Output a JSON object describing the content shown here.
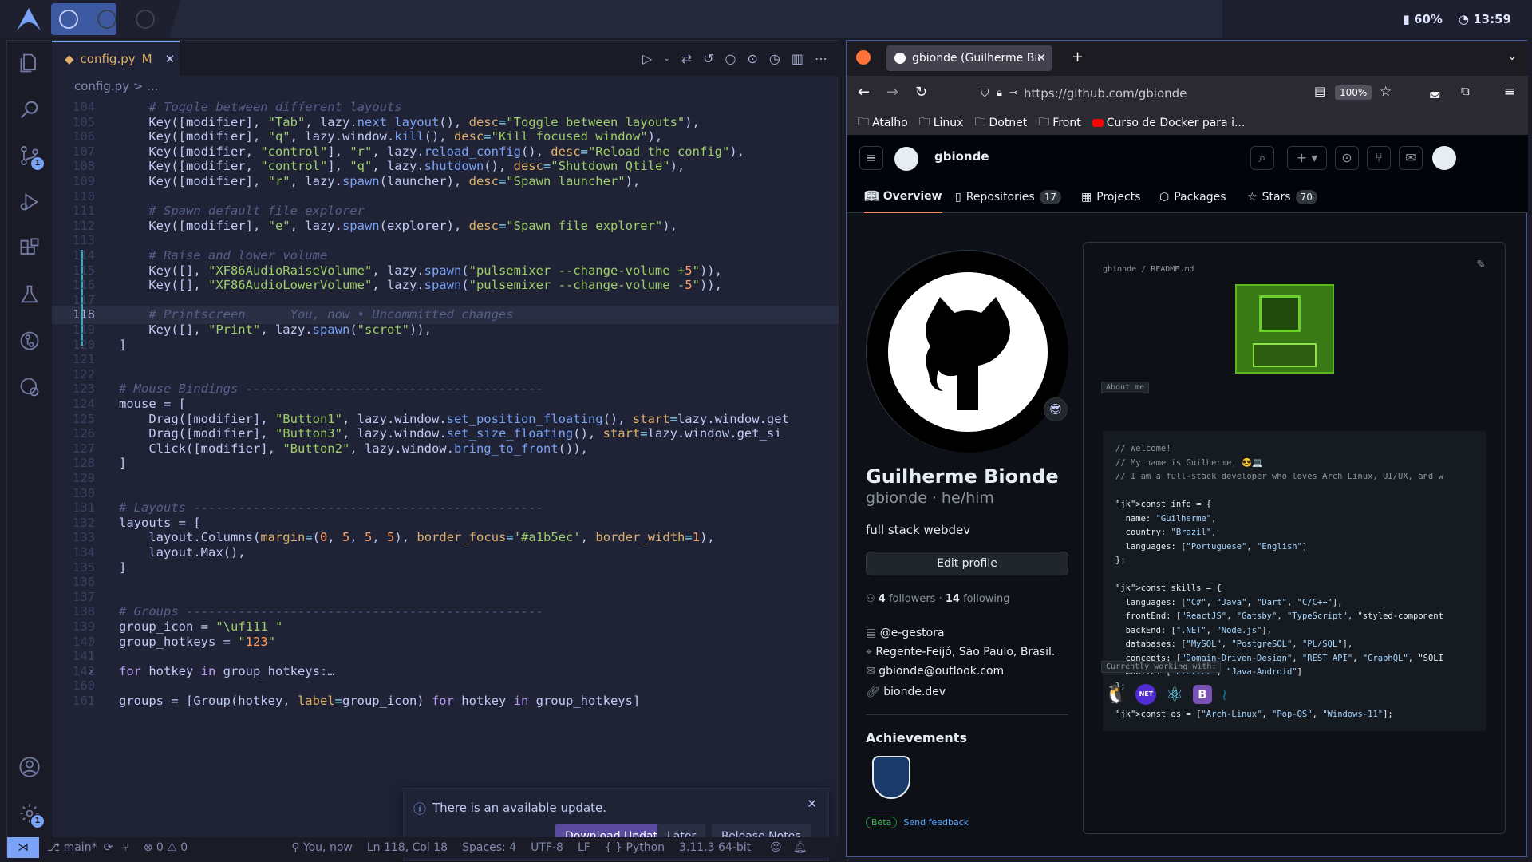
{
  "taskbar": {
    "battery": "60%",
    "time": "13:59",
    "icons": [
      "arch-logo",
      "workspace-1",
      "workspace-2",
      "workspace-3",
      "battery-icon",
      "clock-icon"
    ]
  },
  "editor": {
    "tab_label": "config.py",
    "tab_status": "M",
    "breadcrumb": "config.py > ...",
    "lines": [
      {
        "n": "104",
        "t": "    # Toggle between different layouts"
      },
      {
        "n": "105",
        "t": "    Key([modifier], \"Tab\", lazy.next_layout(), desc=\"Toggle between layouts\"),"
      },
      {
        "n": "106",
        "t": "    Key([modifier], \"q\", lazy.window.kill(), desc=\"Kill focused window\"),"
      },
      {
        "n": "107",
        "t": "    Key([modifier, \"control\"], \"r\", lazy.reload_config(), desc=\"Reload the config\"),"
      },
      {
        "n": "108",
        "t": "    Key([modifier, \"control\"], \"q\", lazy.shutdown(), desc=\"Shutdown Qtile\"),"
      },
      {
        "n": "109",
        "t": "    Key([modifier], \"r\", lazy.spawn(launcher), desc=\"Spawn launcher\"),"
      },
      {
        "n": "110",
        "t": ""
      },
      {
        "n": "111",
        "t": "    # Spawn default file explorer"
      },
      {
        "n": "112",
        "t": "    Key([modifier], \"e\", lazy.spawn(explorer), desc=\"Spawn file explorer\"),"
      },
      {
        "n": "113",
        "t": ""
      },
      {
        "n": "114",
        "t": "    # Raise and lower volume"
      },
      {
        "n": "115",
        "t": "    Key([], \"XF86AudioRaiseVolume\", lazy.spawn(\"pulsemixer --change-volume +5\")),"
      },
      {
        "n": "116",
        "t": "    Key([], \"XF86AudioLowerVolume\", lazy.spawn(\"pulsemixer --change-volume -5\")),"
      },
      {
        "n": "117",
        "t": ""
      },
      {
        "n": "118",
        "t": "    # Printscreen      You, now • Uncommitted changes"
      },
      {
        "n": "119",
        "t": "    Key([], \"Print\", lazy.spawn(\"scrot\")),"
      },
      {
        "n": "120",
        "t": "]"
      },
      {
        "n": "121",
        "t": ""
      },
      {
        "n": "122",
        "t": ""
      },
      {
        "n": "123",
        "t": "# Mouse Bindings ----------------------------------------"
      },
      {
        "n": "124",
        "t": "mouse = ["
      },
      {
        "n": "125",
        "t": "    Drag([modifier], \"Button1\", lazy.window.set_position_floating(), start=lazy.window.get"
      },
      {
        "n": "126",
        "t": "    Drag([modifier], \"Button3\", lazy.window.set_size_floating(), start=lazy.window.get_si"
      },
      {
        "n": "127",
        "t": "    Click([modifier], \"Button2\", lazy.window.bring_to_front()),"
      },
      {
        "n": "128",
        "t": "]"
      },
      {
        "n": "129",
        "t": ""
      },
      {
        "n": "130",
        "t": ""
      },
      {
        "n": "131",
        "t": "# Layouts -----------------------------------------------"
      },
      {
        "n": "132",
        "t": "layouts = ["
      },
      {
        "n": "133",
        "t": "    layout.Columns(margin=(0, 5, 5, 5), border_focus='#a1b5ec', border_width=1),"
      },
      {
        "n": "134",
        "t": "    layout.Max(),"
      },
      {
        "n": "135",
        "t": "]"
      },
      {
        "n": "136",
        "t": ""
      },
      {
        "n": "137",
        "t": ""
      },
      {
        "n": "138",
        "t": "# Groups ------------------------------------------------"
      },
      {
        "n": "139",
        "t": "group_icon = \"\\uf111 \""
      },
      {
        "n": "140",
        "t": "group_hotkeys = \"123\""
      },
      {
        "n": "141",
        "t": ""
      },
      {
        "n": "142",
        "t": "for hotkey in group_hotkeys:…"
      },
      {
        "n": "160",
        "t": ""
      },
      {
        "n": "161",
        "t": "groups = [Group(hotkey, label=group_icon) for hotkey in group_hotkeys]"
      }
    ],
    "notification": {
      "message": "There is an available update.",
      "download": "Download Update",
      "later": "Later",
      "release_notes": "Release Notes"
    },
    "status": {
      "branch": "main*",
      "problems": "0",
      "warnings": "0",
      "blame": "You, now",
      "position": "Ln 118, Col 18",
      "spaces": "Spaces: 4",
      "encoding": "UTF-8",
      "eol": "LF",
      "language": "Python",
      "interpreter": "3.11.3 64-bit"
    },
    "activity_badges": {
      "scm": "1",
      "settings": "1"
    }
  },
  "browser": {
    "tab_title": "gbionde (Guilherme Bionde)",
    "url": "https://github.com/gbionde",
    "zoom": "100%",
    "bookmarks": [
      "Atalho",
      "Linux",
      "Dotnet",
      "Front",
      "Curso de Docker para i..."
    ],
    "github": {
      "username_header": "gbionde",
      "nav": [
        {
          "label": "Overview",
          "count": ""
        },
        {
          "label": "Repositories",
          "count": "17"
        },
        {
          "label": "Projects",
          "count": ""
        },
        {
          "label": "Packages",
          "count": ""
        },
        {
          "label": "Stars",
          "count": "70"
        }
      ],
      "name": "Guilherme Bionde",
      "login_pronouns": "gbionde · he/him",
      "bio": "full stack webdev",
      "edit_profile": "Edit profile",
      "followers": "4",
      "followers_label": "followers",
      "following": "14",
      "following_label": "following",
      "org": "@e-gestora",
      "location": "Regente-Feijó, São Paulo, Brasil.",
      "email": "gbionde@outlook.com",
      "website": "bionde.dev",
      "achievements": "Achievements",
      "beta": "Beta",
      "feedback": "Send feedback",
      "readme_path": "gbionde / README.md",
      "about_tag": "About me",
      "working_tag": "Currently working with:",
      "readme_code": [
        "// Welcome!",
        "// My name is Guilherme, 😎💻",
        "// I am a full-stack developer who loves Arch Linux, UI/UX, and w",
        "",
        "const info = {",
        "  name: \"Guilherme\",",
        "  country: \"Brazil\",",
        "  languages: [\"Portuguese\", \"English\"]",
        "};",
        "",
        "const skills = {",
        "  languages: [\"C#\", \"Java\", \"Dart\", \"C/C++\"],",
        "  frontEnd: [\"ReactJS\", \"Gatsby\", \"TypeScript\", \"styled-component",
        "  backEnd: [\".NET\", \"Node.js\"],",
        "  databases: [\"MySQL\", \"PostgreSQL\", \"PL/SQL\"],",
        "  concepts: [\"Domain-Driven-Design\", \"REST API\", \"GraphQL\", \"SOLI",
        "  mobile: [\"Flutter\", \"Java-Android\"]",
        "};",
        "",
        "const os = [\"Arch-Linux\", \"Pop-OS\", \"Windows-11\"];"
      ],
      "tech_icons": [
        "linux-icon",
        "dotnet-icon",
        "react-icon",
        "bootstrap-icon",
        "mysql-icon"
      ]
    }
  }
}
